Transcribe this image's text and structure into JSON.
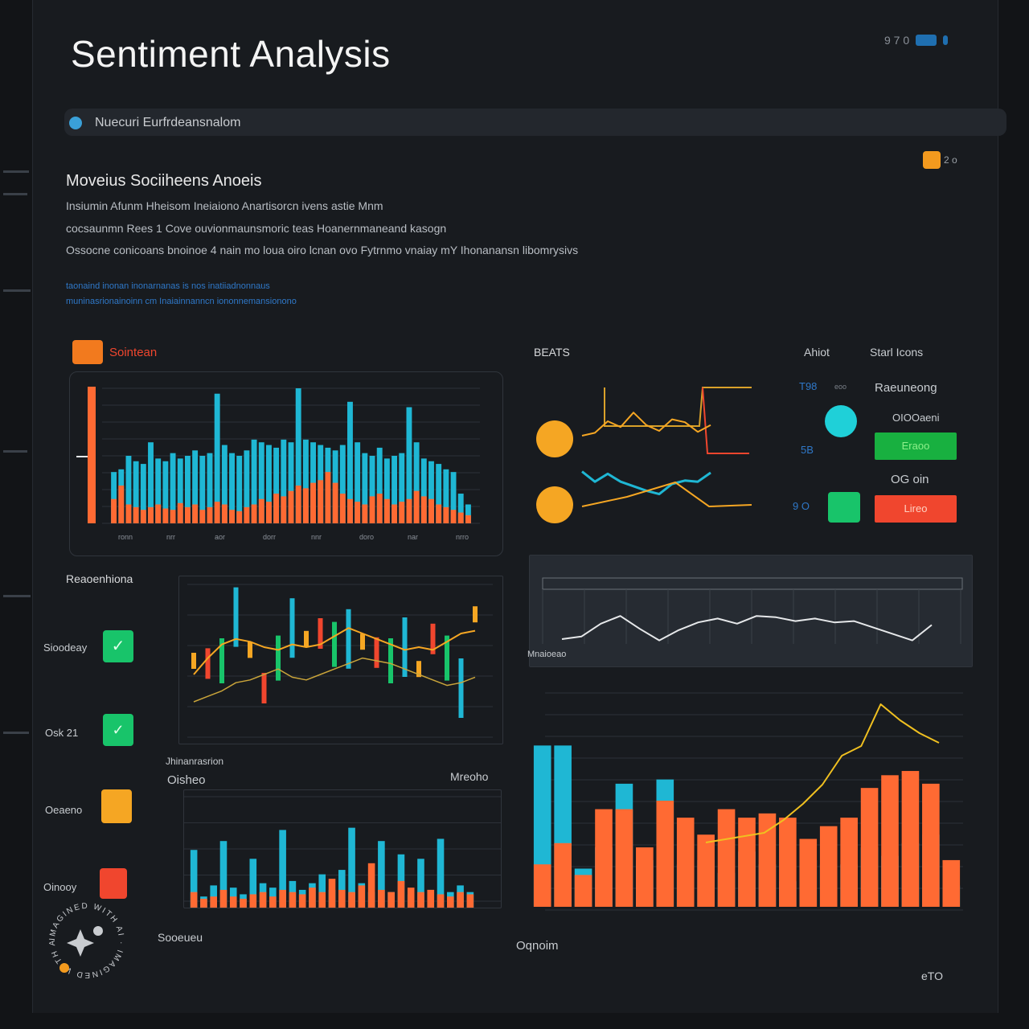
{
  "header": {
    "title": "Sentiment Analysis",
    "status_text": "9 7 0",
    "subbar_label": "Nuecuri Eurfrdeansnalom",
    "corner_badge": "2 o"
  },
  "intro": {
    "heading": "Moveius Sociiheens Anoeis",
    "lines": [
      "Insiumin Afunm Hheisom Ineiaiono Anartisorcn ivens astie Mnm",
      "cocsaunmn Rees 1 Cove ouvionmaunsmoric teas Hoanernmaneand kasogn",
      "Ossocne conicoans bnoinoe 4 nain mo loua oiro lcnan ovo Fytrnmo vnaiay mY Ihonanansn libomrysivs"
    ],
    "links": [
      "taonaind inonan inonarnanas is nos inatiiadnonnaus",
      "muninasrionainoinn cm Inaiainnanncn iononnemansionono"
    ]
  },
  "colors": {
    "orange": "#ff6a33",
    "cyan": "#1fb7d4",
    "green": "#18c46a",
    "yellow": "#f5a623",
    "red": "#f0462e"
  },
  "bar_panel": {
    "label": "Sointean",
    "icon": "chart-icon",
    "tick_labels": [
      "ronn",
      "nrr",
      "aor",
      "dorr",
      "nnr",
      "doro",
      "nar",
      "nrro"
    ]
  },
  "trends": {
    "label": "BEATS",
    "right_heading": "Ahiot",
    "right_heading2": "Starl Icons",
    "mini_labels": [
      "T98",
      "eoo",
      "5B",
      "9 O"
    ],
    "status_labels": [
      "Raeuneong",
      "OIOOaeni",
      "OG oin"
    ],
    "status_buttons": [
      "Eraoo",
      "Lireo"
    ]
  },
  "left_column": {
    "label": "Reaoenhiona",
    "items": [
      "Sioodeay",
      "Osk 21",
      "Oeaeno",
      "Oinooy"
    ]
  },
  "candle_panel": {
    "caption": "Jhinanrasrion",
    "sub_left": "Oisheo",
    "sub_right": "Mreoho"
  },
  "wave_panel": {
    "caption": "Mnaioeao"
  },
  "footer": {
    "left": "Sooeueu",
    "mid": "Oqnoim",
    "right": "eTO"
  },
  "watermark": "IMAGINED WITH AI",
  "chart_data": [
    {
      "type": "bar",
      "title": "",
      "series": [
        {
          "values": [
            18,
            28,
            14,
            12,
            10,
            12,
            14,
            11,
            10,
            15,
            12,
            14,
            10,
            12,
            16,
            14,
            10,
            9,
            12,
            14,
            18,
            16,
            22,
            20,
            24,
            28,
            26,
            30,
            32,
            38,
            30,
            22,
            18,
            16,
            14,
            20,
            22,
            18,
            14,
            16,
            18,
            24,
            20,
            18,
            14,
            12,
            10,
            8,
            6
          ]
        },
        {
          "values": [
            38,
            40,
            50,
            46,
            44,
            60,
            48,
            46,
            52,
            48,
            50,
            54,
            50,
            52,
            96,
            58,
            52,
            50,
            54,
            62,
            60,
            58,
            56,
            62,
            60,
            100,
            62,
            60,
            58,
            56,
            54,
            58,
            90,
            60,
            52,
            50,
            56,
            48,
            50,
            52,
            86,
            60,
            48,
            46,
            44,
            40,
            38,
            22,
            14
          ]
        }
      ],
      "ylim": [
        0,
        100
      ]
    },
    {
      "type": "line",
      "title": "",
      "series": [
        {
          "values": [
            30,
            36,
            60,
            48,
            78,
            52,
            40,
            64,
            58,
            38,
            52
          ]
        },
        {
          "values": [
            62,
            44,
            58,
            44,
            36,
            28,
            22,
            40,
            46,
            44,
            60
          ]
        }
      ],
      "ylim": [
        0,
        100
      ]
    },
    {
      "type": "line",
      "title": "",
      "series": [
        {
          "values": [
            50,
            48,
            50,
            82,
            58,
            30,
            52,
            74,
            66,
            70,
            62,
            66,
            64,
            56,
            50,
            60,
            44,
            66,
            52,
            30,
            84
          ]
        },
        {
          "values": [
            40,
            52,
            62,
            66,
            64,
            60,
            58,
            62,
            60,
            62,
            68,
            74,
            70,
            66,
            62,
            58,
            60,
            58,
            64,
            70,
            72
          ]
        },
        {
          "values": [
            20,
            24,
            28,
            34,
            36,
            40,
            44,
            38,
            36,
            40,
            44,
            48,
            52,
            50,
            48,
            44,
            40,
            36,
            32,
            34,
            38
          ]
        }
      ],
      "ylim": [
        0,
        100
      ]
    },
    {
      "type": "line",
      "title": "",
      "series": [
        {
          "values": [
            20,
            24,
            44,
            56,
            36,
            18,
            34,
            46,
            52,
            44,
            56,
            54,
            48,
            52,
            46,
            48,
            38,
            28,
            18,
            42
          ]
        }
      ],
      "ylim": [
        0,
        100
      ]
    },
    {
      "type": "bar",
      "title": "",
      "series": [
        {
          "values": [
            14,
            8,
            10,
            16,
            10,
            8,
            12,
            14,
            10,
            16,
            14,
            12,
            18,
            14,
            26,
            16,
            14,
            20,
            40,
            16,
            14,
            24,
            18,
            14,
            16,
            12,
            10,
            14,
            12
          ]
        },
        {
          "values": [
            52,
            10,
            20,
            60,
            18,
            12,
            44,
            22,
            18,
            70,
            24,
            16,
            22,
            30,
            16,
            34,
            72,
            22,
            14,
            60,
            14,
            48,
            12,
            44,
            16,
            62,
            14,
            20,
            14
          ]
        }
      ],
      "ylim": [
        0,
        100
      ]
    },
    {
      "type": "bar",
      "title": "",
      "series": [
        {
          "values": [
            20,
            30,
            15,
            46,
            46,
            28,
            50,
            42,
            34,
            46,
            42,
            44,
            42,
            32,
            38,
            42,
            56,
            62,
            64,
            58,
            22
          ]
        },
        {
          "values": [
            76,
            76,
            18,
            28,
            58,
            22,
            60,
            20,
            22,
            16,
            26,
            20,
            12,
            22,
            20,
            20,
            28,
            24,
            30,
            34,
            10
          ]
        }
      ],
      "ylim": [
        0,
        100
      ]
    },
    {
      "type": "line",
      "title": "",
      "series": [
        {
          "values": [
            4,
            6,
            8,
            10,
            18,
            28,
            40,
            58,
            64,
            90,
            80,
            72,
            66
          ]
        }
      ],
      "ylim": [
        0,
        100
      ]
    }
  ]
}
